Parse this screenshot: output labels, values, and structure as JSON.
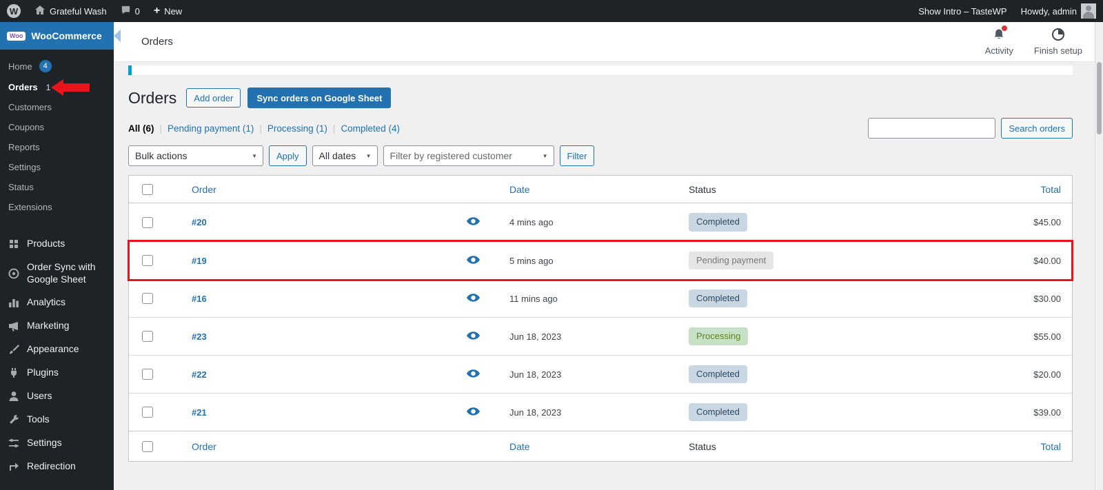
{
  "icons": {
    "wp_logo": "W",
    "woo_logo": "Woo",
    "plus": "+"
  },
  "admin_bar": {
    "site_name": "Grateful Wash",
    "comments_count": "0",
    "new_label": "New",
    "show_intro": "Show Intro – TasteWP",
    "howdy": "Howdy, admin"
  },
  "sidebar": {
    "brand": "WooCommerce",
    "woo_items": [
      {
        "label": "Home",
        "badge": "4"
      },
      {
        "label": "Orders",
        "count": "1"
      },
      {
        "label": "Customers"
      },
      {
        "label": "Coupons"
      },
      {
        "label": "Reports"
      },
      {
        "label": "Settings"
      },
      {
        "label": "Status"
      },
      {
        "label": "Extensions"
      }
    ],
    "menu_items": [
      {
        "label": "Products"
      },
      {
        "label": "Order Sync with Google Sheet"
      },
      {
        "label": "Analytics"
      },
      {
        "label": "Marketing"
      },
      {
        "label": "Appearance"
      },
      {
        "label": "Plugins"
      },
      {
        "label": "Users"
      },
      {
        "label": "Tools"
      },
      {
        "label": "Settings"
      },
      {
        "label": "Redirection"
      }
    ]
  },
  "header": {
    "breadcrumb": "Orders",
    "activity_label": "Activity",
    "finish_setup_label": "Finish setup"
  },
  "page": {
    "title": "Orders",
    "add_order_label": "Add order",
    "sync_label": "Sync orders on Google Sheet",
    "filters": [
      {
        "text": "All (6)",
        "current": true
      },
      {
        "text": "Pending payment (1)"
      },
      {
        "text": "Processing (1)"
      },
      {
        "text": "Completed (4)"
      }
    ],
    "search_button": "Search orders",
    "bulk_actions": "Bulk actions",
    "apply_label": "Apply",
    "all_dates": "All dates",
    "customer_filter": "Filter by registered customer",
    "filter_label": "Filter"
  },
  "table": {
    "headers": {
      "order": "Order",
      "date": "Date",
      "status": "Status",
      "total": "Total"
    },
    "rows": [
      {
        "order": "#20",
        "date": "4 mins ago",
        "status": "Completed",
        "status_type": "completed",
        "total": "$45.00"
      },
      {
        "order": "#19",
        "date": "5 mins ago",
        "status": "Pending payment",
        "status_type": "pending",
        "total": "$40.00",
        "highlighted": true
      },
      {
        "order": "#16",
        "date": "11 mins ago",
        "status": "Completed",
        "status_type": "completed",
        "total": "$30.00"
      },
      {
        "order": "#23",
        "date": "Jun 18, 2023",
        "status": "Processing",
        "status_type": "processing",
        "total": "$55.00"
      },
      {
        "order": "#22",
        "date": "Jun 18, 2023",
        "status": "Completed",
        "status_type": "completed",
        "total": "$20.00"
      },
      {
        "order": "#21",
        "date": "Jun 18, 2023",
        "status": "Completed",
        "status_type": "completed",
        "total": "$39.00"
      }
    ]
  },
  "colors": {
    "accent": "#2271b1",
    "annotation_red": "#e8141c",
    "completed_bg": "#c8d7e1",
    "completed_text": "#2c4861",
    "pending_bg": "#e5e5e5",
    "pending_text": "#777777",
    "processing_bg": "#c6e1c6",
    "processing_text": "#5b841b"
  }
}
